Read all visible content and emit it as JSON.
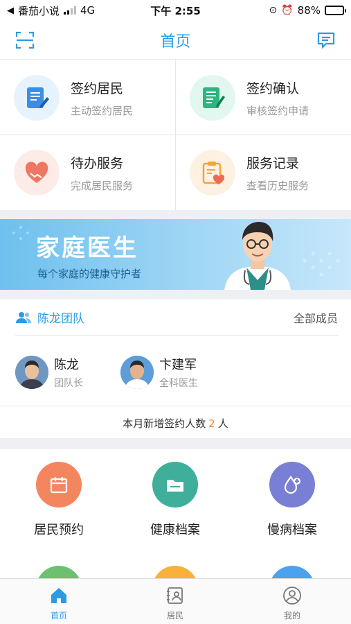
{
  "status_bar": {
    "back_app": "番茄小说",
    "network": "4G",
    "time": "下午 2:55",
    "battery": "88%",
    "battery_level": 0.88
  },
  "navbar": {
    "title": "首页",
    "left_icon": "scan-icon",
    "right_icon": "message-icon"
  },
  "quick_actions": [
    {
      "title": "签约居民",
      "subtitle": "主动签约居民",
      "icon": "sign-document-icon",
      "color": "#3a8ee6",
      "bg": "#e6f3fc"
    },
    {
      "title": "签约确认",
      "subtitle": "审核签约申请",
      "icon": "confirm-document-icon",
      "color": "#2cb57e",
      "bg": "#e2f7ef"
    },
    {
      "title": "待办服务",
      "subtitle": "完成居民服务",
      "icon": "handshake-heart-icon",
      "color": "#ef7662",
      "bg": "#fdebe7"
    },
    {
      "title": "服务记录",
      "subtitle": "查看历史服务",
      "icon": "clipboard-heart-icon",
      "color": "#f5a43a",
      "bg": "#fdf1e1"
    }
  ],
  "banner": {
    "title": "家庭医生",
    "subtitle": "每个家庭的健康守护者"
  },
  "team": {
    "name": "陈龙团队",
    "all_members_label": "全部成员",
    "members": [
      {
        "name": "陈龙",
        "role": "团队长"
      },
      {
        "name": "卞建军",
        "role": "全科医生"
      }
    ],
    "count_prefix": "本月新增签约人数",
    "count": "2",
    "count_suffix": "人"
  },
  "features": [
    {
      "label": "居民预约",
      "icon": "calendar-icon",
      "color": "#f4865f"
    },
    {
      "label": "健康档案",
      "icon": "folder-icon",
      "color": "#3fae9a"
    },
    {
      "label": "慢病档案",
      "icon": "drop-plus-icon",
      "color": "#7a7fd6"
    }
  ],
  "features_partial_colors": [
    "#6cc070",
    "#f7b13c",
    "#4aa3ec"
  ],
  "tabbar": {
    "items": [
      {
        "label": "首页",
        "icon": "home-icon",
        "active": true
      },
      {
        "label": "居民",
        "icon": "resident-card-icon",
        "active": false
      },
      {
        "label": "我的",
        "icon": "profile-icon",
        "active": false
      }
    ]
  },
  "colors": {
    "accent": "#2c9be6",
    "highlight": "#f08a2d"
  }
}
